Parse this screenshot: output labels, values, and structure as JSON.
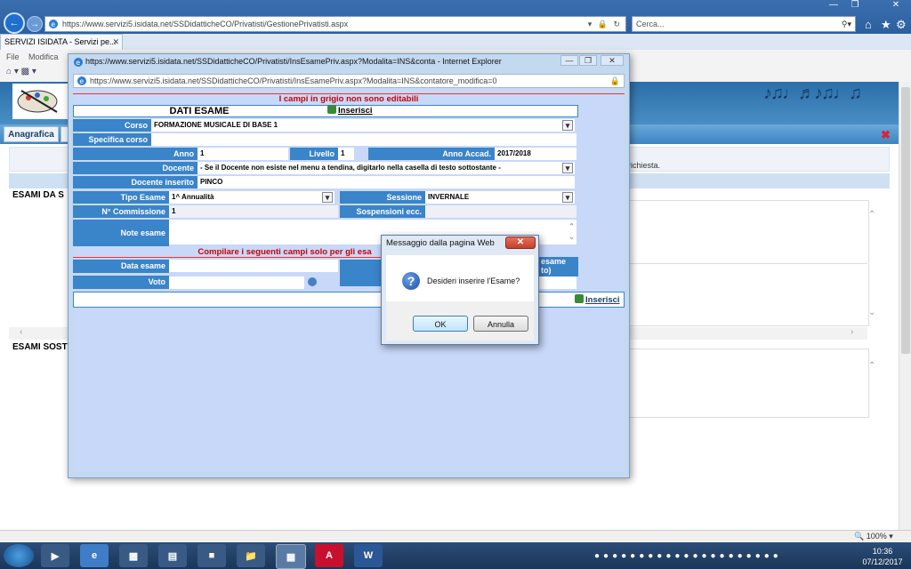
{
  "browser": {
    "url": "https://www.servizi5.isidata.net/SSDidatticheCO/Privatisti/GestionePrivatisti.aspx",
    "url_host": "https://www.servizi5.isidata.net",
    "url_path": "/SSDidatticheCO/Privatisti/GestionePrivatisti.aspx",
    "search_placeholder": "Cerca...",
    "tab_title": "SERVIZI ISIDATA - Servizi pe...",
    "menu": [
      "File",
      "Modifica"
    ],
    "zoom": "100%"
  },
  "site": {
    "tabs": [
      "Anagrafica"
    ],
    "message_fragment": "richiesta.",
    "section1": "ESAMI DA S",
    "section2": "ESAMI SOST"
  },
  "popup": {
    "title": "https://www.servizi5.isidata.net/SSDidatticheCO/Privatisti/InsEsamePriv.aspx?Modalita=INS&conta - Internet Explorer",
    "address": "https://www.servizi5.isidata.net/SSDidatticheCO/Privatisti/InsEsamePriv.aspx?Modalita=INS&contatore_modifica=0",
    "gray_notice": "I campi in grigio non sono editabili",
    "header_title": "DATI ESAME",
    "insert_label": "Inserisci",
    "form": {
      "corso_label": "Corso",
      "corso_value": "FORMAZIONE MUSICALE DI BASE 1",
      "specifica_label": "Specifica corso",
      "anno_label": "Anno",
      "anno_value": "1",
      "livello_label": "Livello",
      "livello_value": "1",
      "anno_accad_label": "Anno Accad.",
      "anno_accad_value": "2017/2018",
      "docente_label": "Docente",
      "docente_value": "- Se il Docente non esiste nel menu a tendina, digitarlo nella casella di testo sottostante -",
      "docente_inserito_label": "Docente inserito",
      "docente_inserito_value": "PINCO",
      "tipo_esame_label": "Tipo Esame",
      "tipo_esame_value": "1^ Annualità",
      "sessione_label": "Sessione",
      "sessione_value": "INVERNALE",
      "commissione_label": "N° Commissione",
      "commissione_value": "1",
      "sospensioni_label": "Sospensioni ecc.",
      "note_label": "Note esame",
      "compilare_notice": "Compilare i seguenti campi solo per gli esa",
      "data_esame_label": "Data esame",
      "voto_label": "Voto",
      "right_frag1": "esame",
      "right_frag2": "to)"
    }
  },
  "dialog": {
    "title": "Messaggio dalla pagina Web",
    "message": "Desideri inserire l'Esame?",
    "ok_label": "OK",
    "cancel_label": "Annulla"
  },
  "taskbar": {
    "time": "10:36",
    "date": "07/12/2017"
  }
}
